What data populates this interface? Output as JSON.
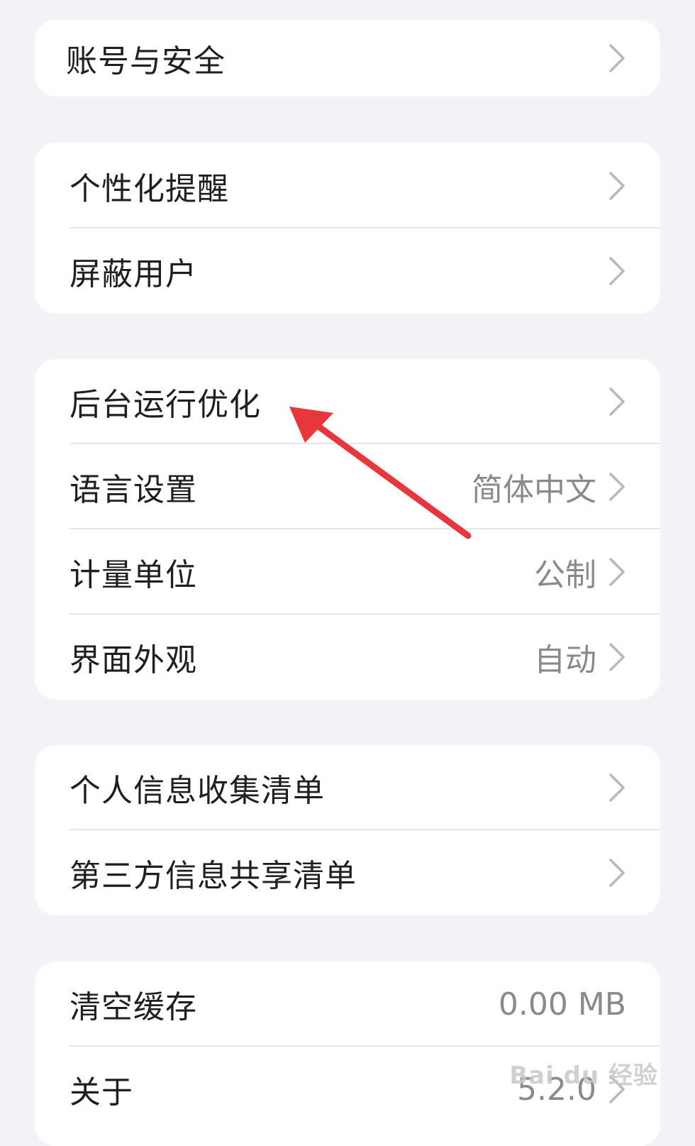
{
  "sections": [
    {
      "items": [
        {
          "label": "账号与安全",
          "value": ""
        }
      ]
    },
    {
      "items": [
        {
          "label": "个性化提醒",
          "value": ""
        },
        {
          "label": "屏蔽用户",
          "value": ""
        }
      ]
    },
    {
      "items": [
        {
          "label": "后台运行优化",
          "value": ""
        },
        {
          "label": "语言设置",
          "value": "简体中文"
        },
        {
          "label": "计量单位",
          "value": "公制"
        },
        {
          "label": "界面外观",
          "value": "自动"
        }
      ]
    },
    {
      "items": [
        {
          "label": "个人信息收集清单",
          "value": ""
        },
        {
          "label": "第三方信息共享清单",
          "value": ""
        }
      ]
    },
    {
      "items": [
        {
          "label": "清空缓存",
          "value": "0.00 MB"
        },
        {
          "label": "关于",
          "value": "5.2.0"
        }
      ]
    }
  ],
  "annotation": {
    "arrow_color": "#e8373c",
    "icon": "arrow-annotation-icon"
  },
  "watermark": {
    "text": "Bai du 经验"
  },
  "colors": {
    "background": "#f2f3f7",
    "card": "#ffffff",
    "label_text": "#1f1f1f",
    "value_text": "#8a8a8e",
    "chevron": "#b8b8bd"
  }
}
